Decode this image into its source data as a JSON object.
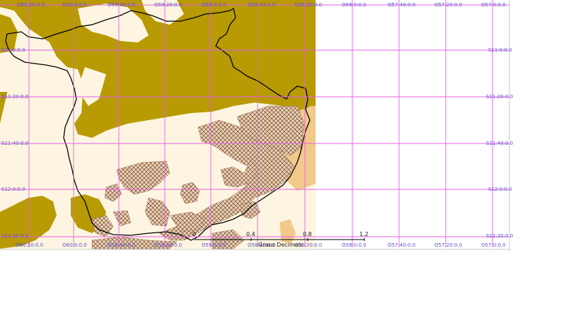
{
  "map": {
    "colors": {
      "background_region": "#fdf5e1",
      "forest": "#b89a04",
      "border": "#000000",
      "grid": "#e45fe6",
      "hatch": "#8a5a3c",
      "label": "#5b4fd1",
      "orange_zone": "#f2c98a"
    },
    "top_labels": [
      "O60:20:0.0",
      "O60:0:0.0",
      "O59:40:0.0",
      "O59:20:0.0",
      "O59:0:0.0",
      "O58:40:0.0",
      "O58:20:0.0",
      "O58:0:0.0",
      "O57:40:0.0",
      "O57:20:0.0",
      "O57:0:0.0"
    ],
    "bottom_labels": [
      "O60:20:0.0",
      "O60:0:0.0",
      "O59:40:0.0",
      "O59:20:0.0",
      "O59:0:0.0",
      "O58:40:0.0",
      "O58:20:0.0",
      "O58:0:0.0",
      "O57:40:0.0",
      "O57:20:0.0",
      "O57:0:0.0"
    ],
    "left_labels": [
      "S11:0:0.0",
      "S11:20:0.0",
      "S11:40:0.0",
      "S12:0:0.0",
      "S12:20:0.0"
    ],
    "right_labels": [
      "S11:0:0.0",
      "S11:20:0.0",
      "S11:40:0.0",
      "S12:0:0.0",
      "S12:20:0.0"
    ],
    "scale_bar": {
      "ticks": [
        "0",
        "0.4",
        "0.8",
        "1.2"
      ],
      "unit": "Graus Decimais"
    }
  }
}
